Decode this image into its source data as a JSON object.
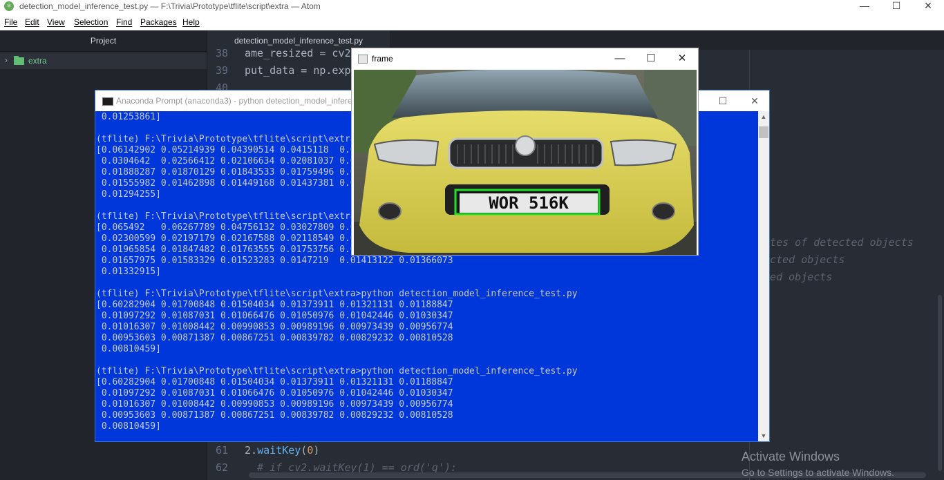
{
  "atom": {
    "window_title": "detection_model_inference_test.py — F:\\Trivia\\Prototype\\tflite\\script\\extra — Atom",
    "window_controls": {
      "minimize": "—",
      "maximize": "☐",
      "close": "✕"
    },
    "menu": [
      "File",
      "Edit",
      "View",
      "Selection",
      "Find",
      "Packages",
      "Help"
    ],
    "tree": {
      "header": "Project",
      "root_folder": "extra"
    },
    "tab": "detection_model_inference_test.py",
    "code_top": [
      {
        "num": "38",
        "text": "ame_resized = cv2"
      },
      {
        "num": "39",
        "text": "put_data = np.exp"
      },
      {
        "num": "40",
        "text": ""
      }
    ],
    "code_right": [
      "nates of detected objects",
      "tected objects",
      "cted objects"
    ],
    "code_bottom": [
      {
        "num": "61",
        "pre": "2.",
        "fn": "waitKey",
        "open": "(",
        "arg": "0",
        "close": ")"
      },
      {
        "num": "62",
        "comment": "  # if cv2.waitKey(1) == ord('q'):"
      }
    ],
    "activate": {
      "title": "Activate Windows",
      "subtitle": "Go to Settings to activate Windows."
    }
  },
  "console": {
    "title": "Anaconda Prompt (anaconda3) - python  detection_model_inference_test.py",
    "lines": [
      " 0.01253861]",
      "",
      "(tflite) F:\\Trivia\\Prototype\\tflite\\script\\extra>python detection_model_inference_test.py",
      "[0.06142902 0.05214939 0.04390514 0.0415118  0.03640143 0.03389826",
      " 0.0304642  0.02566412 0.02106634 0.02081037 0.02002475 0.01930442",
      " 0.01888287 0.01870129 0.01843533 0.01759496 0.01680233 0.01603112",
      " 0.01555982 0.01462898 0.01449168 0.01437381 0.01410054 0.01336412",
      " 0.01294255]",
      "",
      "(tflite) F:\\Trivia\\Prototype\\tflite\\script\\extra>python detection_model_inference_test.py",
      "[0.065492   0.06267789 0.04756132 0.03027809 0.02596134 0.02460158",
      " 0.02300599 0.02197179 0.02167588 0.02118549 0.02063497 0.01996513",
      " 0.01965854 0.01847482 0.01763555 0.01753756 0.01721394 0.01696752",
      " 0.01657975 0.01583329 0.01523283 0.0147219  0.01413122 0.01366073",
      " 0.01332915]",
      "",
      "(tflite) F:\\Trivia\\Prototype\\tflite\\script\\extra>python detection_model_inference_test.py",
      "[0.60282904 0.01700848 0.01504034 0.01373911 0.01321131 0.01188847",
      " 0.01097292 0.01087031 0.01066476 0.01050976 0.01042446 0.01030347",
      " 0.01016307 0.01008442 0.00990853 0.00989196 0.00973439 0.00956774",
      " 0.00953603 0.00871387 0.00867251 0.00839782 0.00829232 0.00810528",
      " 0.00810459]",
      "",
      "(tflite) F:\\Trivia\\Prototype\\tflite\\script\\extra>python detection_model_inference_test.py",
      "[0.60282904 0.01700848 0.01504034 0.01373911 0.01321131 0.01188847",
      " 0.01097292 0.01087031 0.01066476 0.01050976 0.01042446 0.01030347",
      " 0.01016307 0.01008442 0.00990853 0.00989196 0.00973439 0.00956774",
      " 0.00953603 0.00871387 0.00867251 0.00839782 0.00829232 0.00810528",
      " 0.00810459]"
    ]
  },
  "frame": {
    "title": "frame",
    "plate_text": "WOR 516K",
    "box_color": "#22e02a",
    "car_color": "#d8cf52"
  }
}
